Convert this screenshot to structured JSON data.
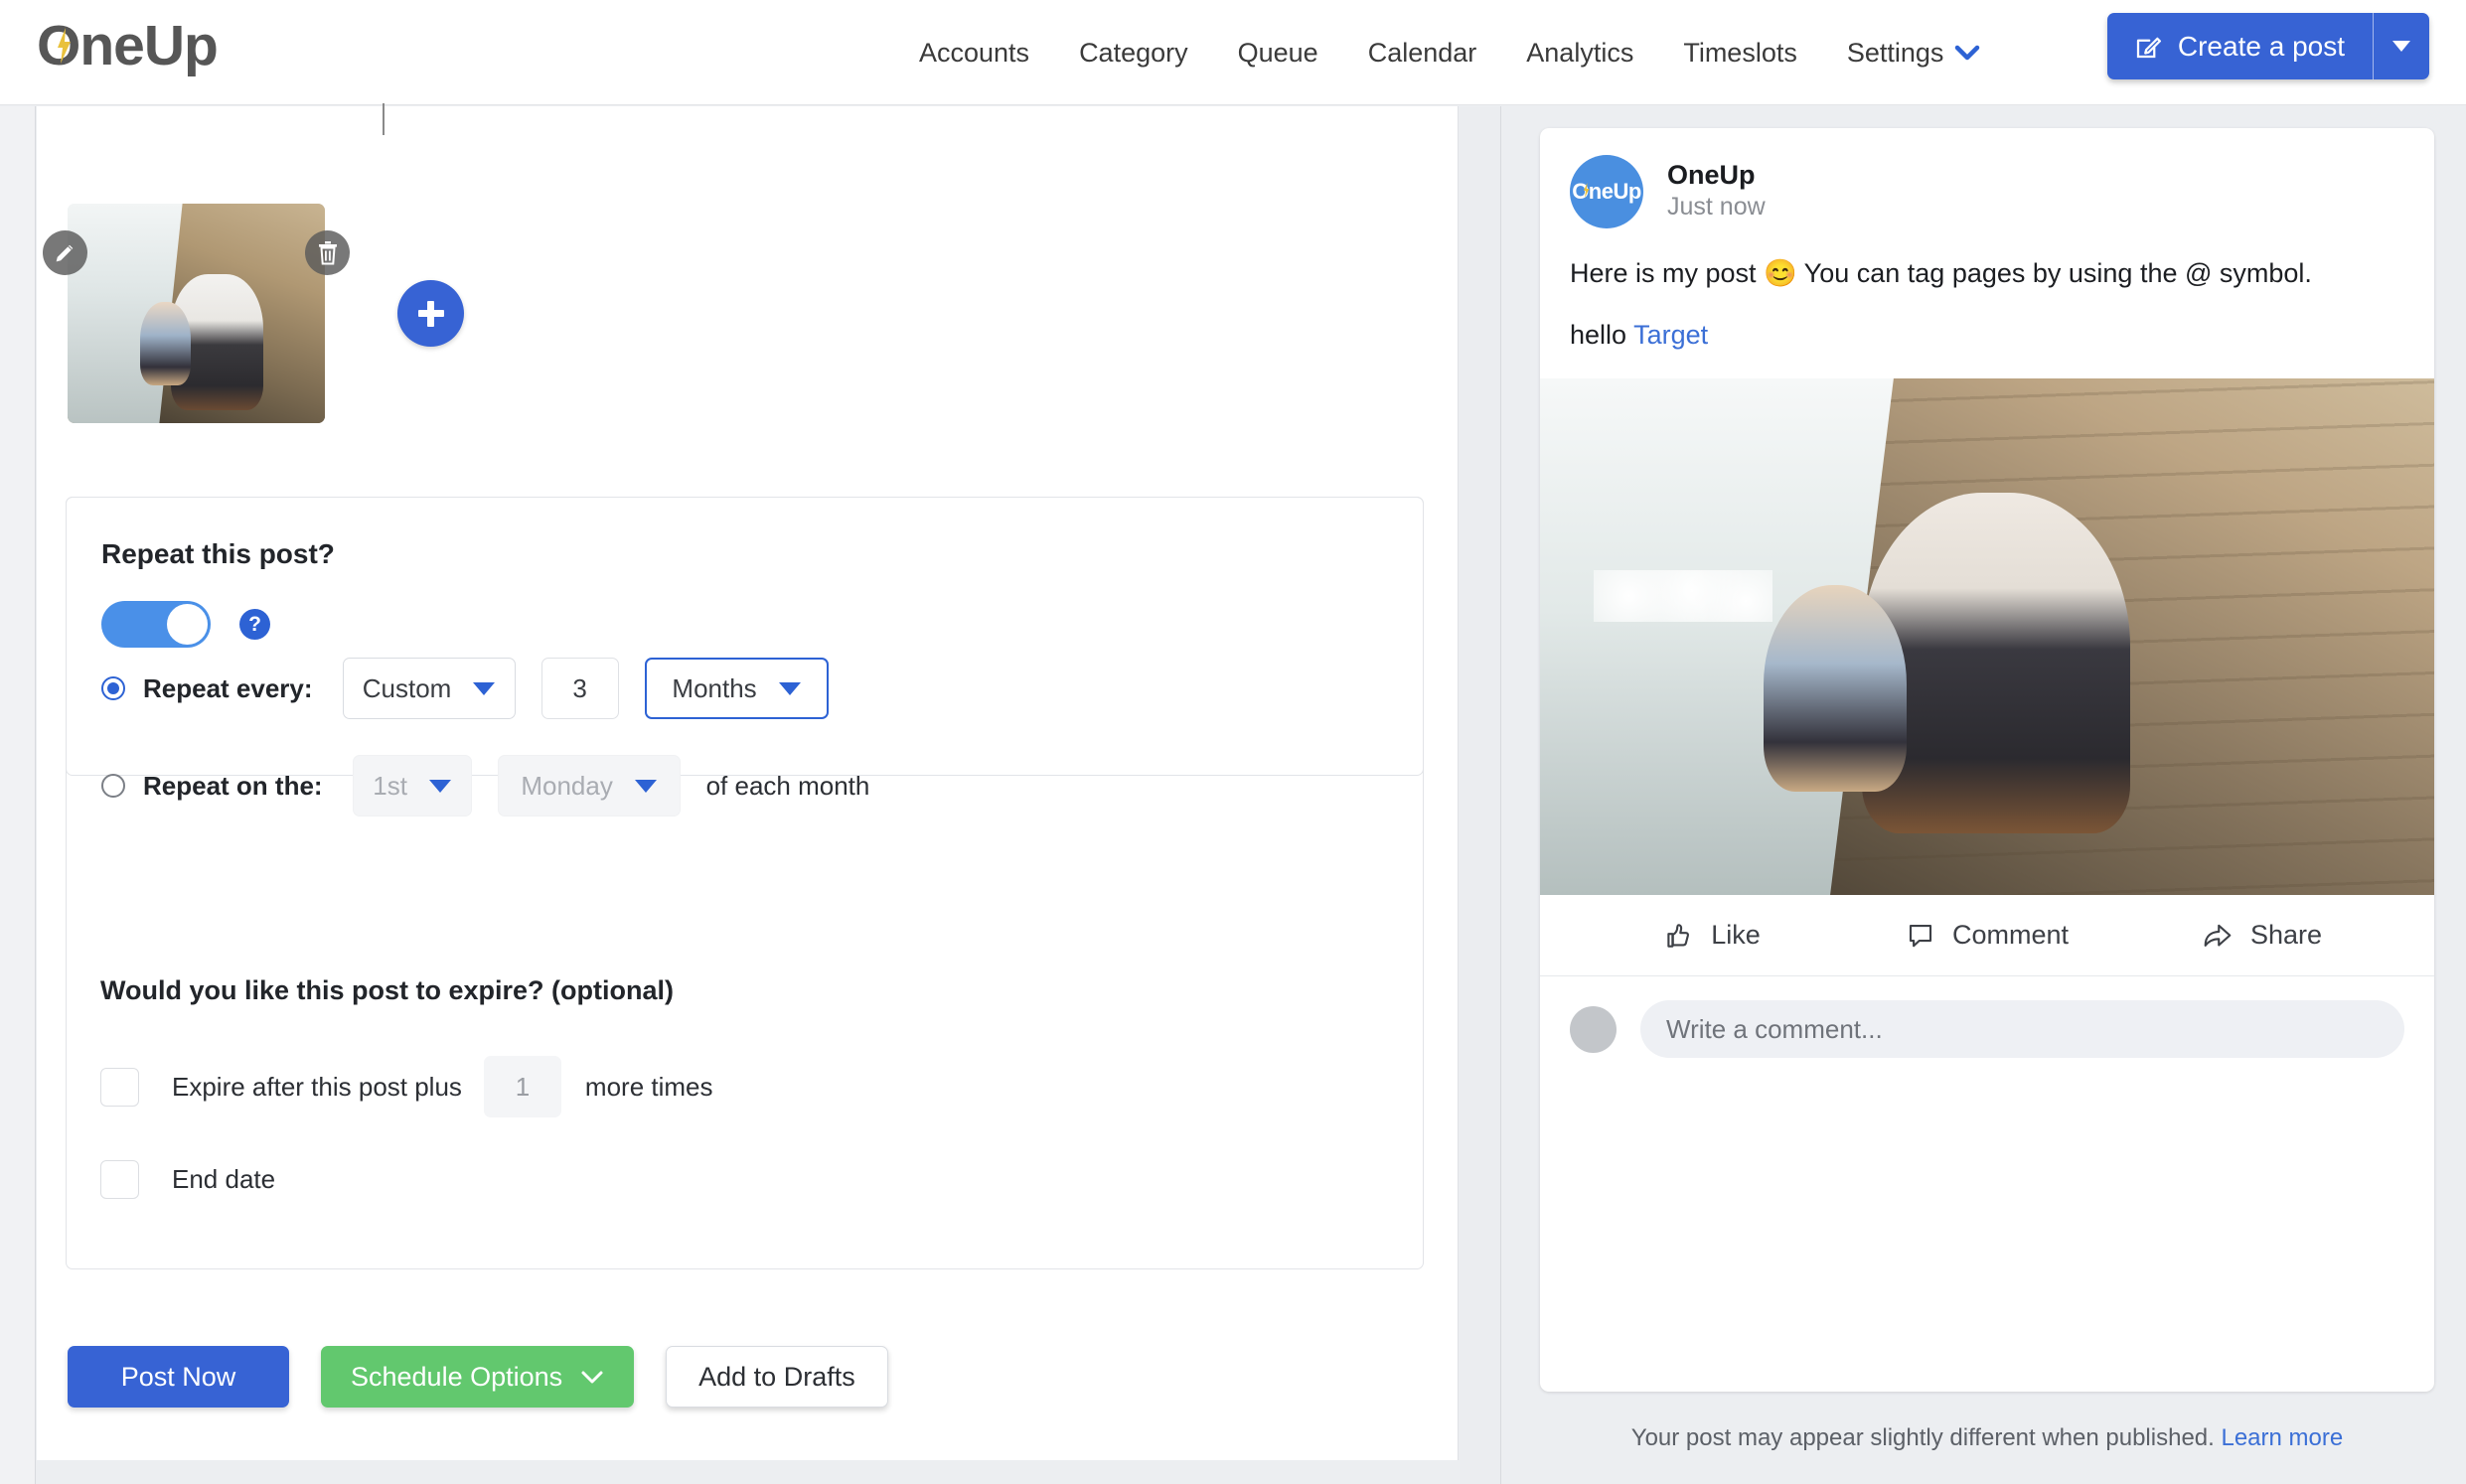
{
  "brand": {
    "name": "OneUp",
    "logo_icon": "oneup-lightning-logo",
    "accent_blue": "#3763d4",
    "accent_green": "#62c86e"
  },
  "topnav": {
    "items": [
      {
        "label": "Accounts",
        "icon": null
      },
      {
        "label": "Category",
        "icon": null
      },
      {
        "label": "Queue",
        "icon": null
      },
      {
        "label": "Calendar",
        "icon": null
      },
      {
        "label": "Analytics",
        "icon": null
      },
      {
        "label": "Timeslots",
        "icon": null
      },
      {
        "label": "Settings",
        "icon": "chevron-down-icon"
      }
    ],
    "create_button": {
      "label": "Create a post",
      "icon": "compose-pencil-icon",
      "caret_icon": "caret-down-icon"
    }
  },
  "media": {
    "thumbnail_alt": "man holding child on wooden dock",
    "edit_icon": "pencil-icon",
    "delete_icon": "trash-icon",
    "add_icon": "plus-icon"
  },
  "repeat": {
    "title": "Repeat this post?",
    "toggle_on": true,
    "help_icon": "question-mark-icon",
    "every_row": {
      "radio_selected": true,
      "label": "Repeat every:",
      "frequency_value": "Custom",
      "interval_value": "3",
      "unit_value": "Months"
    },
    "on_the_row": {
      "radio_selected": false,
      "label": "Repeat on the:",
      "ordinal_value": "1st",
      "weekday_value": "Monday",
      "suffix": "of each month"
    },
    "expire_heading": "Would you like this post to expire? (optional)",
    "expire_after": {
      "checked": false,
      "label_before": "Expire after this post plus",
      "count_value": "1",
      "label_after": "more times"
    },
    "end_date": {
      "checked": false,
      "label": "End date"
    }
  },
  "actions": {
    "post_now": "Post Now",
    "schedule_options": "Schedule Options",
    "schedule_caret_icon": "chevron-down-icon",
    "add_to_drafts": "Add to Drafts"
  },
  "preview": {
    "account_name": "OneUp",
    "timestamp": "Just now",
    "avatar_label": "OneUp",
    "body_line_1": "Here is my post 😊 You can tag pages by using the @ symbol.",
    "body_line_2_text": "hello ",
    "body_line_2_mention": "Target",
    "photo_alt": "man holding child on wooden dock",
    "actions": [
      {
        "label": "Like",
        "icon": "thumbs-up-icon"
      },
      {
        "label": "Comment",
        "icon": "speech-bubble-icon"
      },
      {
        "label": "Share",
        "icon": "share-arrow-icon"
      }
    ],
    "comment_placeholder": "Write a comment...",
    "footnote_text": "Your post may appear slightly different when published. ",
    "footnote_link": "Learn more"
  }
}
